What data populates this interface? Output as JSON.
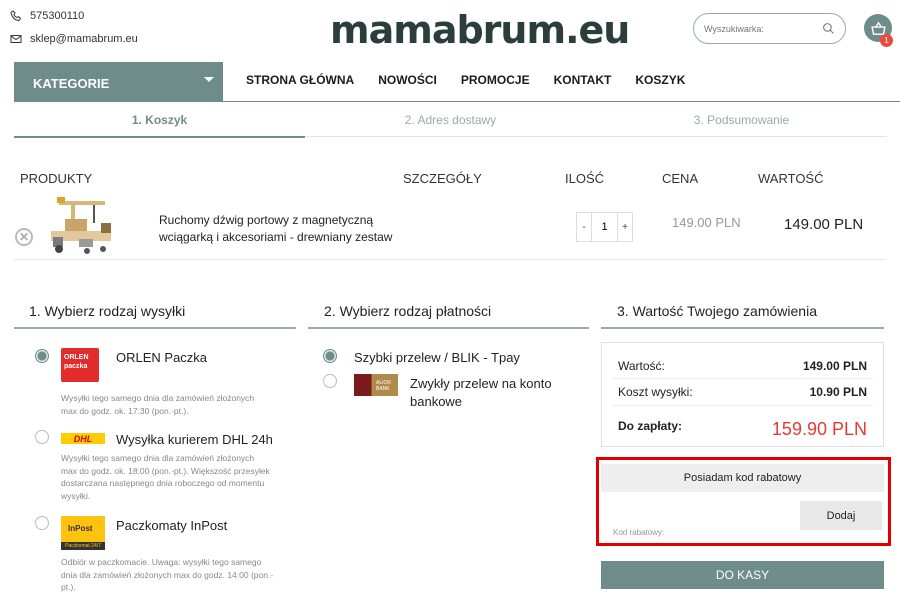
{
  "header": {
    "phone": "575300110",
    "email": "sklep@mamabrum.eu",
    "logo": "mamabrum.eu",
    "search_placeholder": "Wyszukiwarka:",
    "cart_count": "1"
  },
  "nav": {
    "categories": "KATEGORIE",
    "items": [
      "STRONA GŁÓWNA",
      "NOWOŚCI",
      "PROMOCJE",
      "KONTAKT",
      "KOSZYK"
    ]
  },
  "steps": [
    "1. Koszyk",
    "2. Adres dostawy",
    "3. Podsumowanie"
  ],
  "cart": {
    "headers": [
      "PRODUKTY",
      "SZCZEGÓŁY",
      "ILOŚĆ",
      "CENA",
      "WARTOŚĆ"
    ],
    "product": {
      "name": "Ruchomy dźwig portowy z magnetyczną wciągarką i akcesoriami - drewniany zestaw",
      "qty": "1",
      "minus": "-",
      "plus": "+",
      "price": "149.00 PLN",
      "value": "149.00 PLN"
    }
  },
  "shipping": {
    "title": "1. Wybierz rodzaj wysyłki",
    "options": [
      {
        "logo": "ORLEN paczka",
        "name": "ORLEN Paczka",
        "desc": "Wysyłki tego samego dnia dla zamówień złożonych max do godz. ok. 17:30 (pon.-pt.).",
        "selected": true
      },
      {
        "logo": "DHL",
        "name": "Wysyłka kurierem DHL 24h",
        "desc": "Wysyłki tego samego dnia dla zamówień złożonych max do godz. ok. 18:00 (pon.-pt.). Większość przesyłek dostarczana następnego dnia roboczego od momentu wysyłki.",
        "selected": false
      },
      {
        "logo": "InPost",
        "logo_sub": "Paczkomat 24/7",
        "name": "Paczkomaty InPost",
        "desc": "Odbiór w paczkomacie. Uwaga: wysyłki tego samego dnia dla zamówień złożonych max do godz. 14:00 (pon.-pt.).",
        "selected": false
      }
    ]
  },
  "payment": {
    "title": "2. Wybierz rodzaj płatności",
    "options": [
      {
        "name": "Szybki przelew / BLIK - Tpay",
        "selected": true
      },
      {
        "logo": "ALIOR BANK",
        "name": "Zwykły przelew na konto bankowe",
        "selected": false
      }
    ]
  },
  "summary": {
    "title": "3. Wartość Twojego zamówienia",
    "value_label": "Wartość:",
    "value": "149.00 PLN",
    "shipping_label": "Koszt wysyłki:",
    "shipping": "10.90 PLN",
    "total_label": "Do zapłaty:",
    "total": "159.90 PLN",
    "discount_button": "Posiadam kod rabatowy",
    "apply_button": "Dodaj",
    "code_label": "Kod rabatowy:",
    "checkout_button": "DO KASY"
  },
  "colors": {
    "accent": "#6e8c89",
    "total_red": "#e53935",
    "highlight_border": "#e00000"
  }
}
